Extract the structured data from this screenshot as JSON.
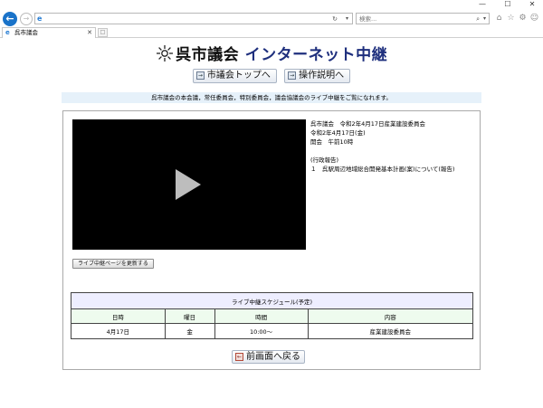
{
  "browser": {
    "address_value": "",
    "search_placeholder": "検索...",
    "tab_title": "呉市議会",
    "window_controls": {
      "minimize": "—",
      "maximize": "☐",
      "close": "✕"
    },
    "icons": [
      "back-arrow-icon",
      "forward-arrow-icon",
      "ie-logo-icon",
      "reload-icon",
      "search-icon",
      "home-icon",
      "star-icon",
      "gear-icon",
      "smiley-icon"
    ]
  },
  "page": {
    "logo_title_main": "呉市議会",
    "logo_title_sub": "インターネット中継",
    "nav_buttons": [
      {
        "label": "市議会トップへ"
      },
      {
        "label": "操作説明へ"
      }
    ],
    "notice": "呉市議会の本会議，常任委員会，特別委員会，議会協議会のライブ中継をご覧になれます。",
    "info_lines": [
      "呉市議会　令和2年4月17日産業建設委員会",
      "令和2年4月17日(金)",
      "開会　午前10時",
      "",
      "(行政報告)",
      "１　呉駅周辺地域総合開発基本計画(案)について(報告)"
    ],
    "refresh_button": "ライブ中継ページを更新する",
    "schedule": {
      "caption": "ライブ中継スケジュール(予定)",
      "headers": [
        "日時",
        "曜日",
        "時間",
        "内容"
      ],
      "rows": [
        [
          "4月17日",
          "金",
          "10:00〜",
          "産業建設委員会"
        ]
      ]
    },
    "back_button": "前画面へ戻る"
  }
}
